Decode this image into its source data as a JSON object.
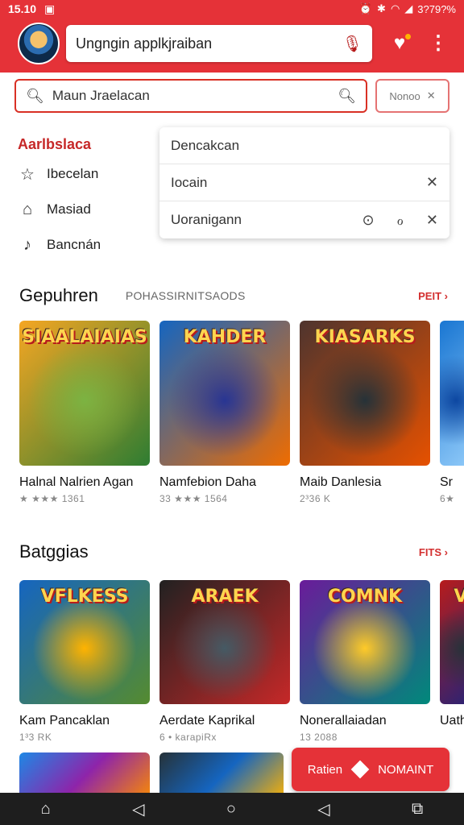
{
  "status": {
    "time": "15.10",
    "battery": "3?79?%"
  },
  "topbar": {
    "search_text": "Ungngin applkjraiban"
  },
  "search": {
    "value": "Maun Jraelacan",
    "chip_label": "Nonoo"
  },
  "menu": {
    "heading": "Aarlbslaca",
    "items": [
      {
        "label": "Ibecelan",
        "icon": "star-outline-icon"
      },
      {
        "label": "Masiad",
        "icon": "home-outline-icon"
      },
      {
        "label": "Bancnán",
        "icon": "bell-outline-icon"
      }
    ]
  },
  "dropdown": {
    "rows": [
      {
        "label": "Dencakcan"
      },
      {
        "label": "Iocain"
      },
      {
        "label": "Uoranigann"
      }
    ]
  },
  "section1": {
    "title": "Gepuhren",
    "subtitle": "POHASSIRNITSAODS",
    "more": "PEIT",
    "cards": [
      {
        "name": "Halnal Nalrien Agan",
        "meta": "★ ★★★ 1361",
        "art_text": "SIAALAIAIAS",
        "colors": [
          "#f5a623",
          "#2e7d32",
          "#7cb342"
        ]
      },
      {
        "name": "Namfebion Daha",
        "meta": "33 ★★★ 1564",
        "art_text": "KAHDER",
        "colors": [
          "#1565c0",
          "#ef6c00",
          "#283593"
        ]
      },
      {
        "name": "Maib Danlesia",
        "meta": "2³36 K",
        "art_text": "KIASARKS",
        "colors": [
          "#4e342e",
          "#e65100",
          "#263238"
        ]
      },
      {
        "name": "Sr",
        "meta": "6★",
        "art_text": "",
        "colors": [
          "#1976d2",
          "#90caf9",
          "#0d47a1"
        ]
      }
    ]
  },
  "section2": {
    "title": "Batggias",
    "more": "FITS",
    "cards": [
      {
        "name": "Kam Pancaklan",
        "meta": "1³3 RK",
        "art_text": "VFLKESS",
        "colors": [
          "#1565c0",
          "#558b2f",
          "#ffb300"
        ]
      },
      {
        "name": "Aerdate Kaprikal",
        "meta": "6 • karapiRx",
        "art_text": "ARAEK",
        "colors": [
          "#212121",
          "#c62828",
          "#455a64"
        ]
      },
      {
        "name": "Nonerallaiadan",
        "meta": "13 2088",
        "art_text": "COMNK",
        "colors": [
          "#6a1b9a",
          "#00897b",
          "#ffca28"
        ]
      },
      {
        "name": "Uathoc",
        "meta": "",
        "art_text": "VI",
        "colors": [
          "#b71c1c",
          "#1a237e",
          "#263238"
        ]
      }
    ]
  },
  "fab": {
    "label1": "Ratien",
    "label2": "NOMAINT"
  },
  "nav": {
    "home": "home-icon",
    "back": "back-icon",
    "circle": "home-circle-icon",
    "recents": "recents-icon"
  }
}
